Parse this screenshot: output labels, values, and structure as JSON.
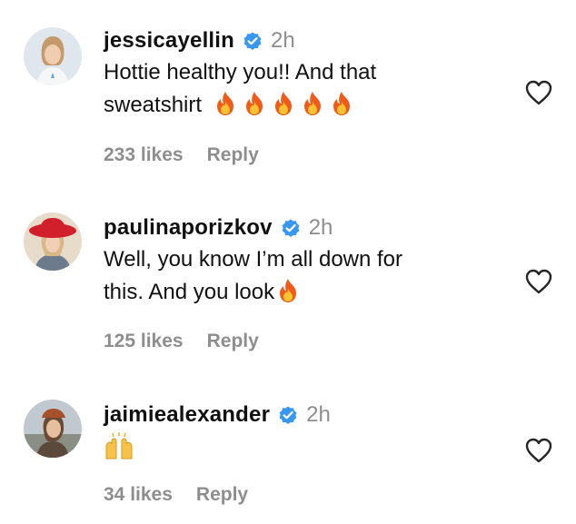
{
  "comments": [
    {
      "username": "jessicayellin",
      "time": "2h",
      "text_line1": "Hottie healthy you!! And that",
      "text_line2": "sweatshirt",
      "emoji_count": 5,
      "likes": "233 likes",
      "reply": "Reply"
    },
    {
      "username": "paulinaporizkov",
      "time": "2h",
      "text_line1": "Well, you know I’m all down for",
      "text_line2": "this. And you look",
      "emoji_count": 1,
      "likes": "125 likes",
      "reply": "Reply"
    },
    {
      "username": "jaimiealexander",
      "time": "2h",
      "emoji": "raising-hands",
      "likes": "34 likes",
      "reply": "Reply"
    }
  ],
  "colors": {
    "text": "#111111",
    "muted": "#8e8e8e",
    "verified": "#3897f0",
    "fire_outer": "#f25a1a",
    "fire_inner": "#ffc233"
  },
  "icons": {
    "verified": "verified-badge-icon",
    "like": "heart-outline-icon",
    "fire": "fire-emoji",
    "hands": "raising-hands-emoji"
  }
}
